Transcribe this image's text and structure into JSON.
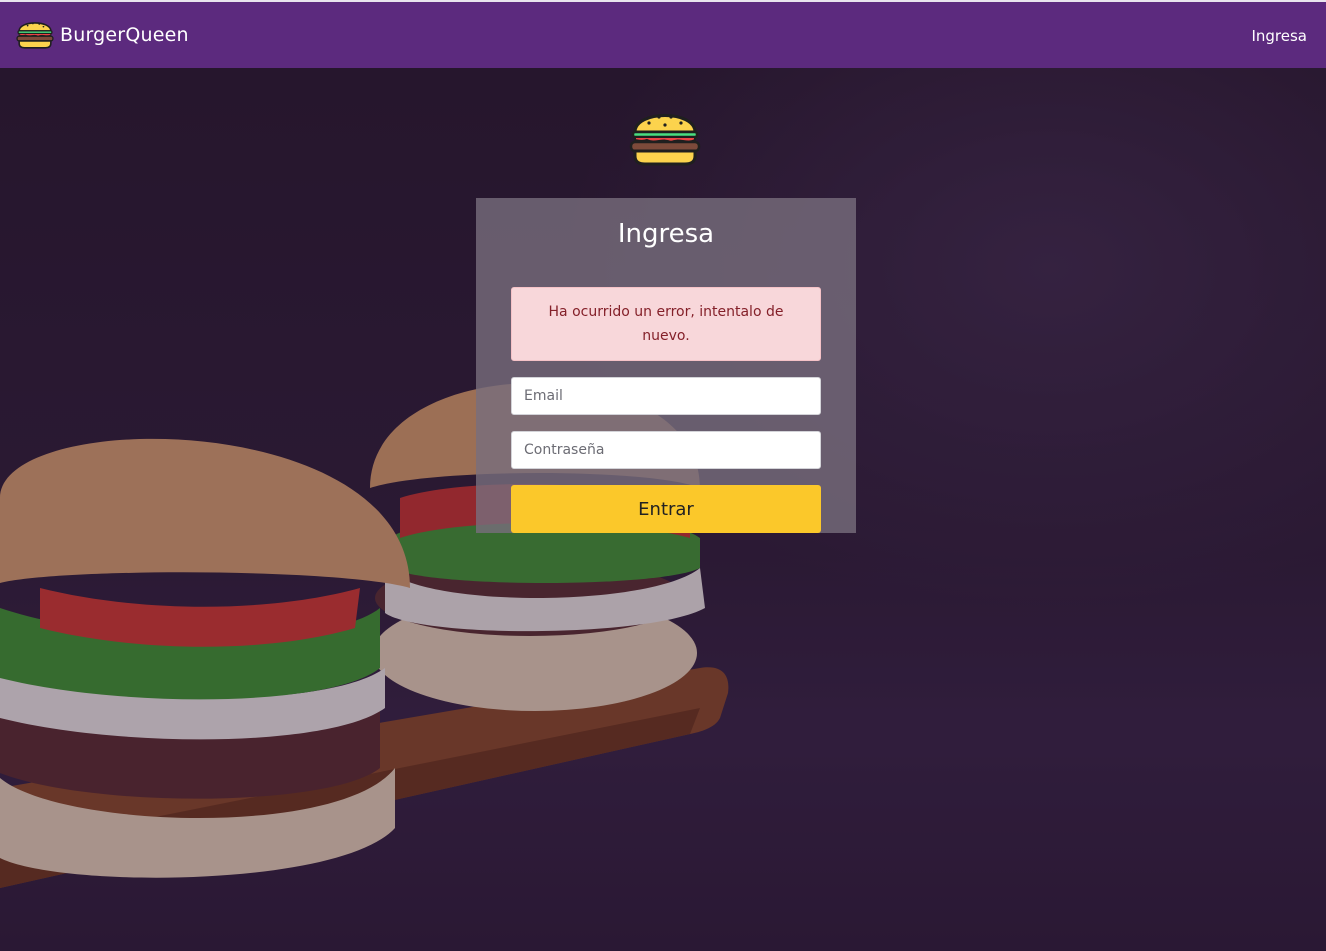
{
  "navbar": {
    "brand_name": "BurgerQueen",
    "login_link": "Ingresa"
  },
  "login": {
    "title": "Ingresa",
    "error_message": "Ha ocurrido un error, intentalo de nuevo.",
    "email_placeholder": "Email",
    "password_placeholder": "Contraseña",
    "submit_label": "Entrar"
  },
  "icons": {
    "brand": "burger-icon",
    "hero": "burger-icon"
  },
  "colors": {
    "navbar": "#5c2a7e",
    "accent": "#fbc82a",
    "alert_bg": "#f8d7da",
    "alert_text": "#842029"
  }
}
